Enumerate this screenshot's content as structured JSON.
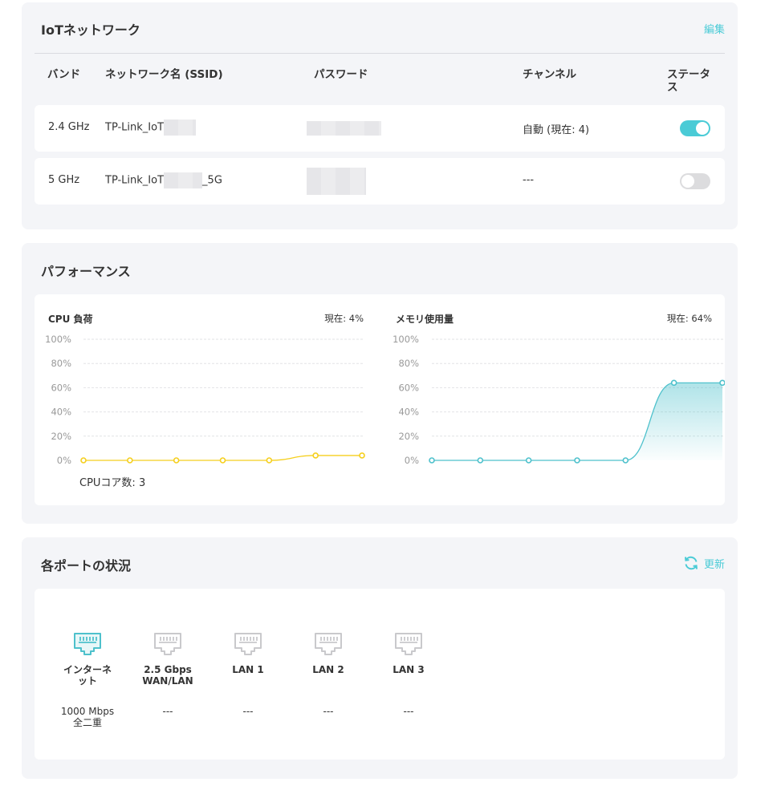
{
  "iot": {
    "title": "IoTネットワーク",
    "edit_label": "編集",
    "headers": {
      "band": "バンド",
      "ssid": "ネットワーク名 (SSID)",
      "password": "パスワード",
      "channel": "チャンネル",
      "status": "ステータス"
    },
    "rows": [
      {
        "band": "2.4 GHz",
        "ssid_prefix": "TP-Link_IoT",
        "ssid_suffix": "",
        "channel": "自動 (現在: 4)",
        "enabled": true
      },
      {
        "band": "5 GHz",
        "ssid_prefix": "TP-Link_IoT",
        "ssid_suffix": "_5G",
        "channel": "---",
        "enabled": false
      }
    ]
  },
  "performance": {
    "title": "パフォーマンス",
    "cpu": {
      "title": "CPU 負荷",
      "current": "現在: 4%",
      "note": "CPUコア数: 3",
      "color": "#f5cf1d"
    },
    "memory": {
      "title": "メモリ使用量",
      "current": "現在: 64%",
      "color": "#4ec1cc"
    }
  },
  "chart_data": [
    {
      "type": "line",
      "title": "CPU 負荷",
      "yticks": [
        "100%",
        "80%",
        "60%",
        "40%",
        "20%",
        "0%"
      ],
      "ylim": [
        0,
        100
      ],
      "values": [
        0,
        0,
        0,
        0,
        0,
        4,
        4
      ],
      "grid": true
    },
    {
      "type": "area",
      "title": "メモリ使用量",
      "yticks": [
        "100%",
        "80%",
        "60%",
        "40%",
        "20%",
        "0%"
      ],
      "ylim": [
        0,
        100
      ],
      "values": [
        0,
        0,
        0,
        0,
        0,
        64,
        64
      ],
      "grid": true
    }
  ],
  "ports": {
    "title": "各ポートの状況",
    "refresh_label": "更新",
    "items": [
      {
        "name_l1": "インターネ",
        "name_l2": "ット",
        "val_l1": "1000 Mbps",
        "val_l2": "全二重",
        "active": true
      },
      {
        "name_l1": "2.5 Gbps",
        "name_l2": "WAN/LAN",
        "val_l1": "---",
        "val_l2": "",
        "active": false
      },
      {
        "name_l1": "LAN 1",
        "name_l2": "",
        "val_l1": "---",
        "val_l2": "",
        "active": false
      },
      {
        "name_l1": "LAN 2",
        "name_l2": "",
        "val_l1": "---",
        "val_l2": "",
        "active": false
      },
      {
        "name_l1": "LAN 3",
        "name_l2": "",
        "val_l1": "---",
        "val_l2": "",
        "active": false
      }
    ]
  },
  "icons": {
    "refresh": "refresh-icon",
    "ethernet_port": "ethernet-port-icon"
  }
}
